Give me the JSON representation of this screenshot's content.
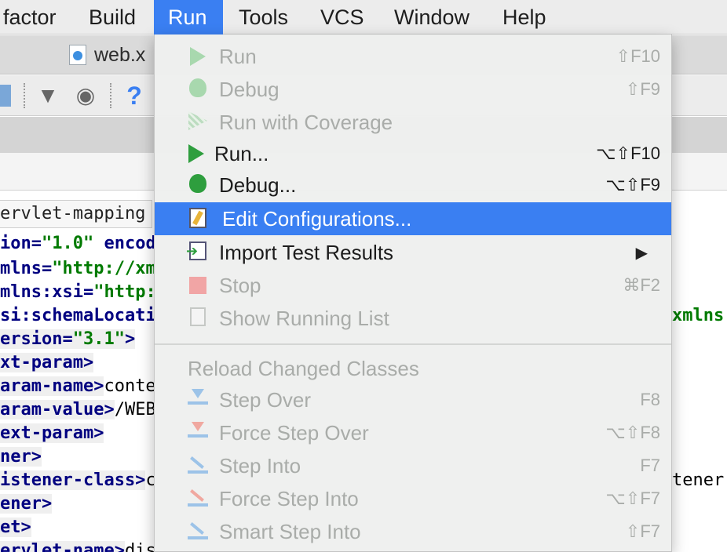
{
  "menubar": {
    "items": [
      "factor",
      "Build",
      "Run",
      "Tools",
      "VCS",
      "Window",
      "Help"
    ],
    "active": "Run"
  },
  "editor_tab": {
    "label": "web.x"
  },
  "breadcrumb": "ervlet-mapping",
  "code_lines": [
    {
      "pre": "ion=",
      "str": "\"1.0\"",
      "post": " encod"
    },
    {
      "pre": "mlns=",
      "str": "\"http://xm",
      "post": ""
    },
    {
      "pre": "mlns:xsi=",
      "str": "\"http:",
      "post": ""
    },
    {
      "pre": "si:schemaLocati",
      "str": "",
      "post": ""
    },
    {
      "pre": "ersion=",
      "str": "\"3.1\"",
      "post": ">"
    },
    {
      "pre": "xt-param>",
      "str": "",
      "post": ""
    },
    {
      "pre": "aram-name>",
      "txt": "conte"
    },
    {
      "pre": "aram-value>",
      "txt": "/WEB"
    },
    {
      "pre": "ext-param>",
      "str": "",
      "post": ""
    },
    {
      "pre": "ner>",
      "str": "",
      "post": ""
    },
    {
      "pre": "istener-class>",
      "txt": "c"
    },
    {
      "pre": "ener>",
      "str": "",
      "post": ""
    },
    {
      "pre": "et>",
      "str": "",
      "post": ""
    },
    {
      "pre": "ervlet-name>",
      "txt": "dis"
    }
  ],
  "right_fragments": {
    "xmlns": "xmlns.",
    "tener": "tener"
  },
  "menu": {
    "items": [
      {
        "id": "run-dim",
        "label": "Run",
        "shortcut": "⇧F10",
        "enabled": false
      },
      {
        "id": "debug-dim",
        "label": "Debug",
        "shortcut": "⇧F9",
        "enabled": false
      },
      {
        "id": "coverage",
        "label": "Run with Coverage",
        "shortcut": "",
        "enabled": false
      },
      {
        "id": "run-dots",
        "label": "Run...",
        "shortcut": "⌥⇧F10",
        "enabled": true
      },
      {
        "id": "debug-dots",
        "label": "Debug...",
        "shortcut": "⌥⇧F9",
        "enabled": true
      },
      {
        "id": "edit-config",
        "label": "Edit Configurations...",
        "shortcut": "",
        "enabled": true,
        "highlighted": true
      },
      {
        "id": "import-tests",
        "label": "Import Test Results",
        "shortcut": "",
        "enabled": true,
        "submenu": true
      },
      {
        "id": "stop",
        "label": "Stop",
        "shortcut": "⌘F2",
        "enabled": false
      },
      {
        "id": "running-list",
        "label": "Show Running List",
        "shortcut": "",
        "enabled": false
      }
    ],
    "section_header": "Reload Changed Classes",
    "debug_items": [
      {
        "id": "step-over",
        "label": "Step Over",
        "shortcut": "F8"
      },
      {
        "id": "force-step-over",
        "label": "Force Step Over",
        "shortcut": "⌥⇧F8"
      },
      {
        "id": "step-into",
        "label": "Step Into",
        "shortcut": "F7"
      },
      {
        "id": "force-step-into",
        "label": "Force Step Into",
        "shortcut": "⌥⇧F7"
      },
      {
        "id": "smart-step-into",
        "label": "Smart Step Into",
        "shortcut": "⇧F7"
      }
    ],
    "submenu_arrow": "▶"
  },
  "toolbar": {
    "help_glyph": "?"
  },
  "colors": {
    "accent": "#3a7ff2",
    "green": "#2e9e3e"
  }
}
